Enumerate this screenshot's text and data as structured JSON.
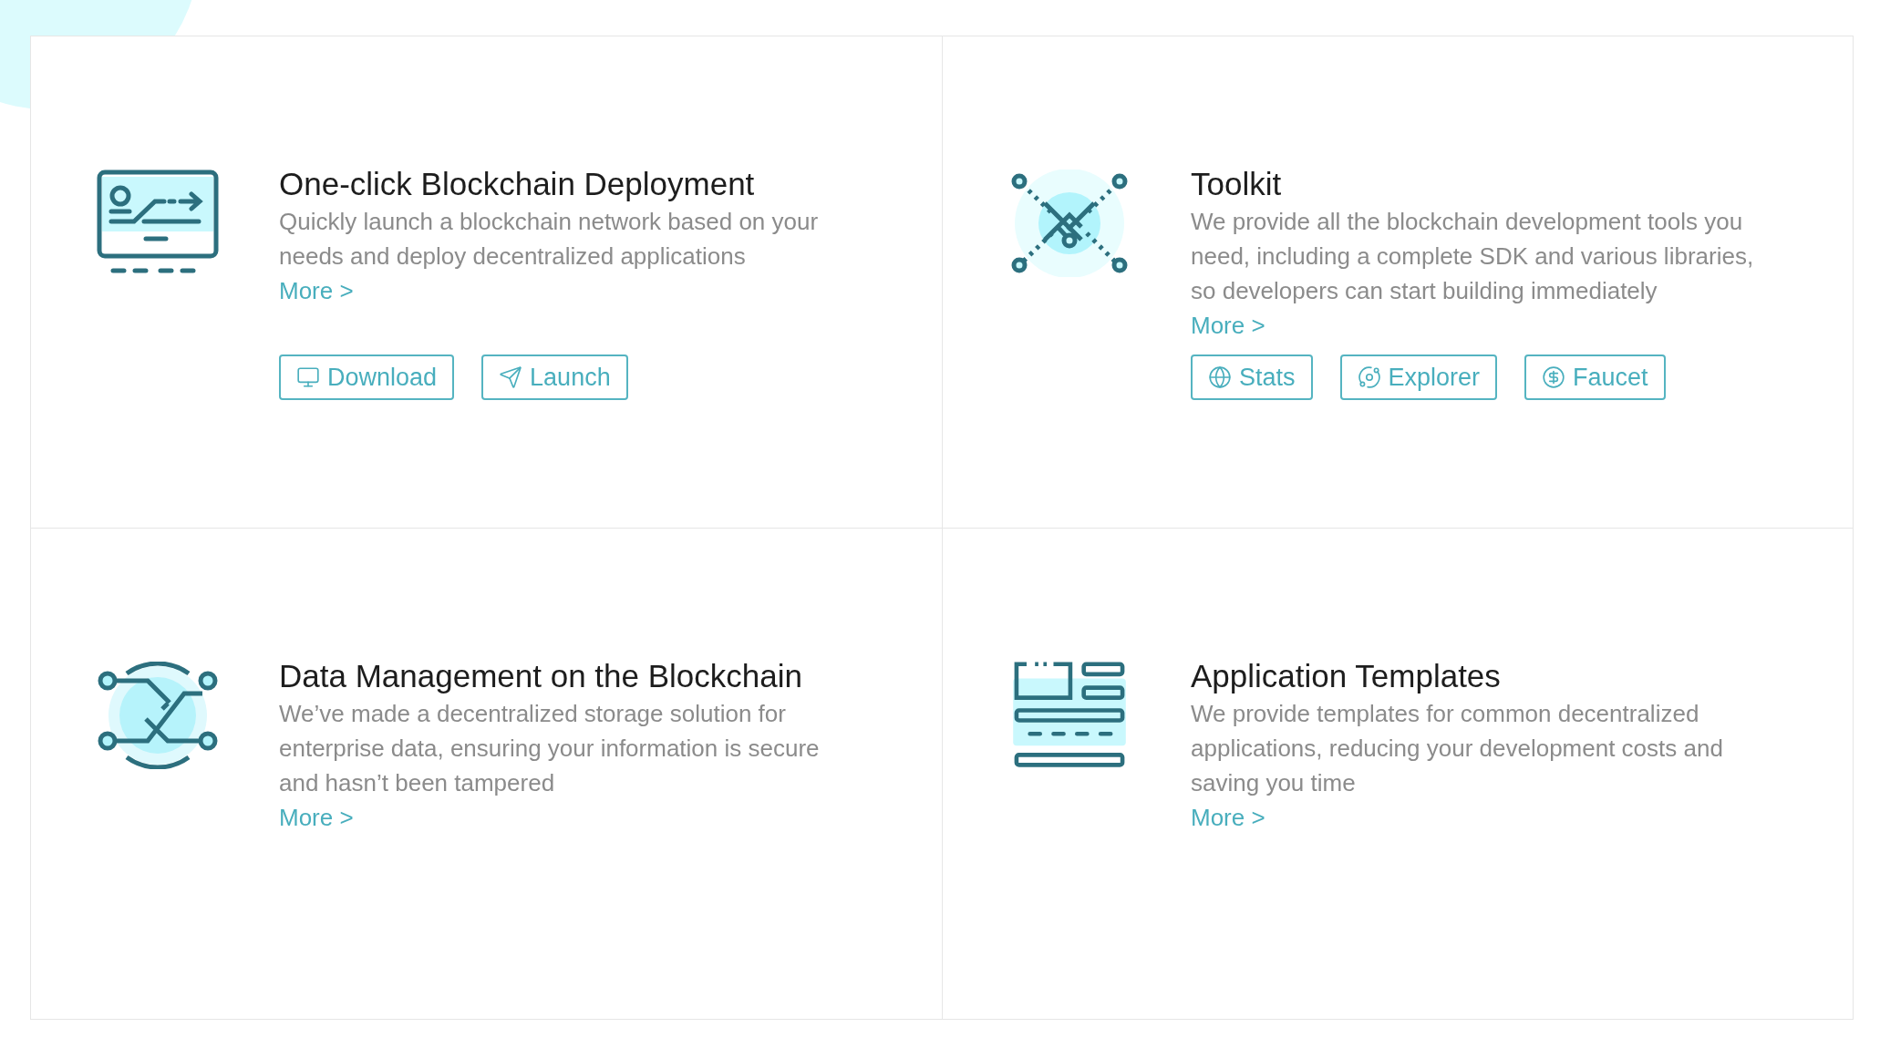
{
  "features": [
    {
      "title": "One-click Blockchain Deployment",
      "description": [
        "Quickly launch a blockchain network based on your",
        "needs and deploy decentralized applications"
      ],
      "more": "More >",
      "buttons": [
        {
          "label": "Download"
        },
        {
          "label": "Launch"
        }
      ]
    },
    {
      "title": "Toolkit",
      "description": [
        "We provide all the blockchain development tools you",
        "need, including a complete SDK and various libraries,",
        "so developers can start building immediately"
      ],
      "more": "More >",
      "buttons": [
        {
          "label": "Stats"
        },
        {
          "label": "Explorer"
        },
        {
          "label": "Faucet"
        }
      ]
    },
    {
      "title": "Data Management on the Blockchain",
      "description": [
        "We’ve made a decentralized storage solution for",
        "enterprise data, ensuring your information is secure",
        "and hasn’t been tampered"
      ],
      "more": "More >"
    },
    {
      "title": "Application Templates",
      "description": [
        "We provide templates for common decentralized",
        "applications, reducing your development costs and",
        "saving you time"
      ],
      "more": "More >"
    }
  ]
}
